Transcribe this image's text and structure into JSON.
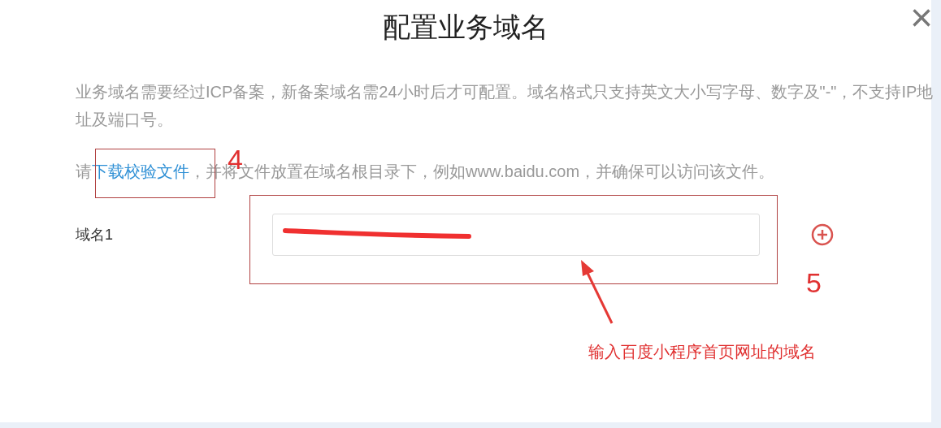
{
  "dialog": {
    "title": "配置业务域名",
    "close": "×"
  },
  "notice": "业务域名需要经过ICP备案，新备案域名需24小时后才可配置。域名格式只支持英文大小写字母、数字及\"-\"，不支持IP地址及端口号。",
  "instruction": {
    "before": "请",
    "link": "下载校验文件",
    "after": "，并将文件放置在域名根目录下，例如www.baidu.com，并确保可以访问该文件。"
  },
  "domains": [
    {
      "label": "域名1"
    }
  ],
  "annotations": [
    {
      "kind": "step",
      "text": "4"
    },
    {
      "kind": "step",
      "text": "5"
    },
    {
      "kind": "note",
      "text": "输入百度小程序首页网址的域名"
    }
  ]
}
